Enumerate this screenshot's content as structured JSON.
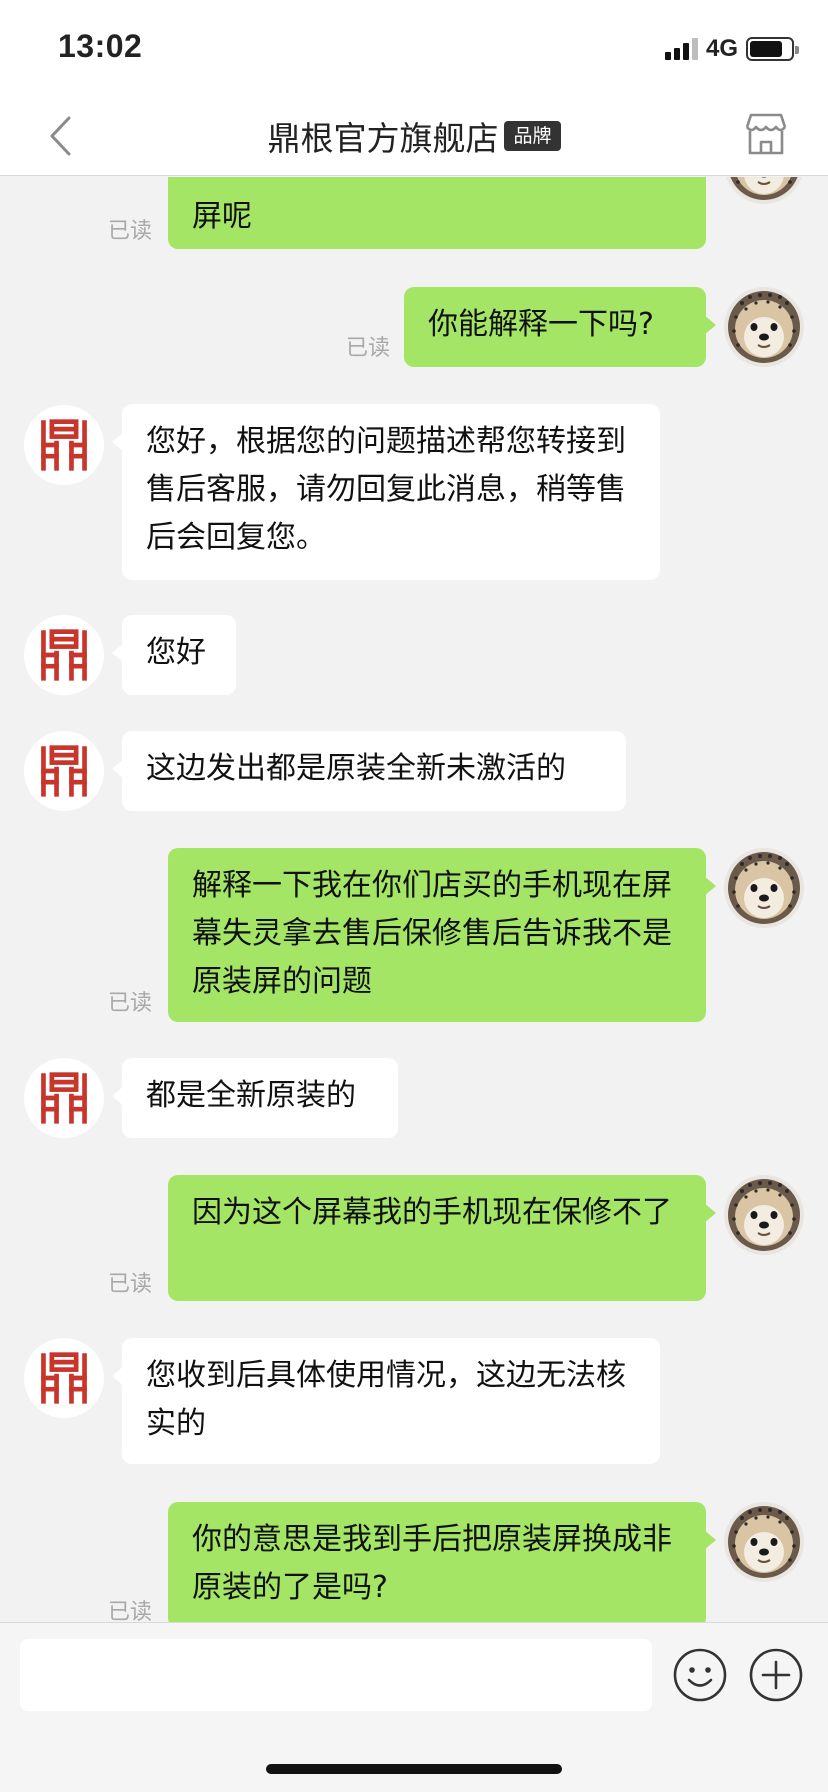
{
  "status_bar": {
    "time": "13:02",
    "network": "4G",
    "battery_level": 0.8
  },
  "nav": {
    "title": "鼎根官方旗舰店",
    "badge": "品牌"
  },
  "read_label": "已读",
  "messages": [
    {
      "sender": "me",
      "text": "屏呢",
      "status": "已读"
    },
    {
      "sender": "me",
      "text": "你能解释一下吗?",
      "status": "已读"
    },
    {
      "sender": "store",
      "text": "您好，根据您的问题描述帮您转接到售后客服，请勿回复此消息，稍等售后会回复您。"
    },
    {
      "sender": "store",
      "text": "您好"
    },
    {
      "sender": "store",
      "text": "这边发出都是原装全新未激活的"
    },
    {
      "sender": "me",
      "text": "解释一下我在你们店买的手机现在屏幕失灵拿去售后保修售后告诉我不是原装屏的问题",
      "status": "已读"
    },
    {
      "sender": "store",
      "text": "都是全新原装的"
    },
    {
      "sender": "me",
      "text": "因为这个屏幕我的手机现在保修不了",
      "status": "已读"
    },
    {
      "sender": "store",
      "text": "您收到后具体使用情况，这边无法核实的"
    },
    {
      "sender": "me",
      "text": "你的意思是我到手后把原装屏换成非原装的了是吗?",
      "status": "已读"
    }
  ],
  "input": {
    "placeholder": ""
  },
  "icons": {
    "back": "chevron-left-icon",
    "store": "store-icon",
    "emoji": "emoji-icon",
    "plus": "plus-icon",
    "store_avatar": "ding-logo-icon"
  },
  "colors": {
    "my_bubble": "#a5e566",
    "their_bubble": "#ffffff",
    "background": "#f2f2f2",
    "logo_red": "#c8362b"
  }
}
